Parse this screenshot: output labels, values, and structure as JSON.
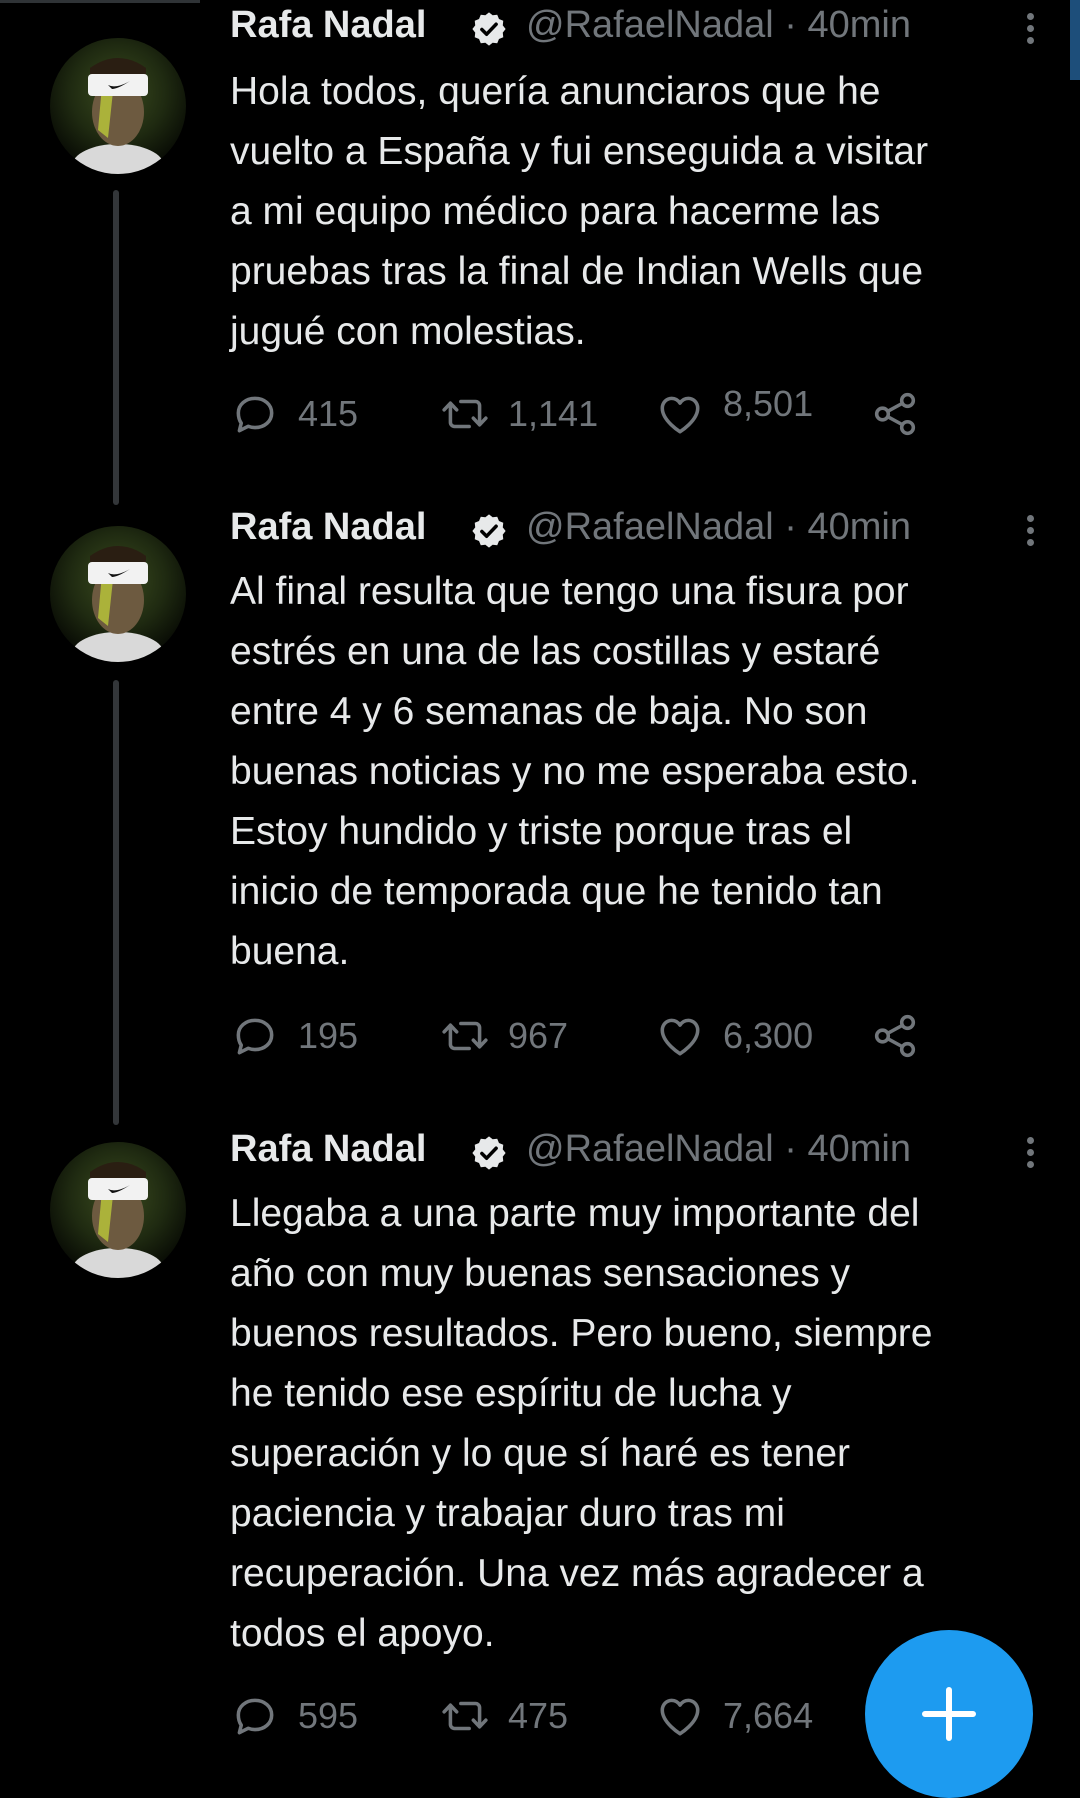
{
  "colors": {
    "background": "#000000",
    "text": "#e7e9ea",
    "secondary": "#71767b",
    "accent": "#1d9bf0"
  },
  "tweets": [
    {
      "name": "Rafa Nadal",
      "handle_time": "@RafaelNadal · 40min",
      "text": "Hola todos, quería anunciaros que he\nvuelto a España y fui enseguida a visitar\na mi equipo médico para hacerme las\npruebas tras la final de Indian Wells que\njugué con molestias.",
      "replies": "415",
      "retweets": "1,141",
      "likes": "8,501"
    },
    {
      "name": "Rafa Nadal",
      "handle_time": "@RafaelNadal · 40min",
      "text": "Al final resulta que tengo una fisura por\nestrés en una de las costillas y estaré\nentre 4 y 6 semanas de baja. No son\nbuenas noticias y no me esperaba esto.\nEstoy hundido y triste porque tras el\ninicio de temporada que he tenido tan\nbuena.",
      "replies": "195",
      "retweets": "967",
      "likes": "6,300"
    },
    {
      "name": "Rafa Nadal",
      "handle_time": "@RafaelNadal · 40min",
      "text": "Llegaba a una parte muy importante del\naño con muy buenas sensaciones y\nbuenos resultados. Pero bueno, siempre\nhe tenido ese espíritu de lucha y\nsuperación y lo que sí haré es tener\npaciencia y trabajar duro tras mi\nrecuperación. Una vez más agradecer a\ntodos el apoyo.",
      "replies": "595",
      "retweets": "475",
      "likes": "7,664"
    }
  ],
  "icons": {
    "verified": "verified-badge-icon",
    "more": "more-options-icon",
    "reply": "reply-icon",
    "retweet": "retweet-icon",
    "like": "heart-icon",
    "share": "share-icon",
    "compose": "plus-icon"
  }
}
